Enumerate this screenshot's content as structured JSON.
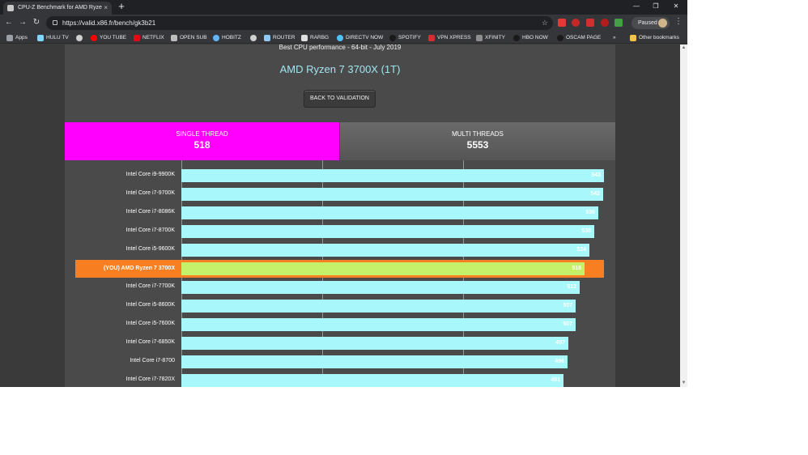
{
  "browser": {
    "tab_title": "CPU-Z Benchmark for AMD Ryze",
    "tab_close": "×",
    "new_tab": "+",
    "url": "https://valid.x86.fr/bench/gk3b21",
    "profile_label": "Paused",
    "window_controls": [
      "—",
      "❐",
      "✕"
    ],
    "bookmarks": [
      {
        "label": "Apps",
        "icon": "apps-grid-icon"
      },
      {
        "label": "HULU TV",
        "icon": "hulu-icon"
      },
      {
        "label": "",
        "icon": "globe-icon"
      },
      {
        "label": "YOU TUBE",
        "icon": "youtube-icon"
      },
      {
        "label": "NETFLIX",
        "icon": "netflix-icon"
      },
      {
        "label": "OPEN SUB",
        "icon": "opensub-icon"
      },
      {
        "label": "HOBITZ",
        "icon": "hobitz-icon"
      },
      {
        "label": "",
        "icon": "globe-icon"
      },
      {
        "label": "ROUTER",
        "icon": "router-icon"
      },
      {
        "label": "RARBG",
        "icon": "rarbg-icon"
      },
      {
        "label": "DIRECTV NOW",
        "icon": "directv-icon"
      },
      {
        "label": "SPOTIFY",
        "icon": "spotify-icon"
      },
      {
        "label": "VPN XPRESS",
        "icon": "vpn-icon"
      },
      {
        "label": "XFINITY",
        "icon": "xfinity-icon"
      },
      {
        "label": "HBO NOW",
        "icon": "hbo-icon"
      },
      {
        "label": "OSCAM PAGE",
        "icon": "oscam-icon"
      }
    ],
    "bookmarks_overflow": "»",
    "other_bookmarks": "Other bookmarks"
  },
  "page": {
    "subtitle": "Best CPU performance - 64-bit - July 2019",
    "cpu_title": "AMD Ryzen 7 3700X (1T)",
    "back_button": "BACK TO VALIDATION",
    "tabs": {
      "single": {
        "label": "SINGLE THREAD",
        "score": "518"
      },
      "multi": {
        "label": "MULTI THREADS",
        "score": "5553"
      }
    }
  },
  "chart_data": {
    "type": "bar",
    "orientation": "horizontal",
    "categories": [
      "Intel Core i9-9900K",
      "Intel Core i7-9700K",
      "Intel Core i7-8086K",
      "Intel Core i7-8700K",
      "Intel Core i5-9600K",
      "(YOU) AMD Ryzen 7 3700X",
      "Intel Core i7-7700K",
      "Intel Core i5-8600K",
      "Intel Core i5-7600K",
      "Intel Core i7-6850K",
      "Intel Core i7-8700",
      "Intel Core i7-7820X"
    ],
    "values": [
      543,
      542,
      536,
      530,
      524,
      518,
      512,
      507,
      507,
      497,
      496,
      491
    ],
    "value_labels": [
      "543",
      "542",
      "536",
      "530",
      "524",
      "518",
      "512",
      "507",
      "507",
      "497",
      "496",
      "491"
    ],
    "highlight_index": 5,
    "xlim": [
      0,
      543
    ],
    "grid": true,
    "bar_color": "#a8f7fb",
    "highlight_bar_color": "#c5f06a",
    "highlight_row_color": "#f77f22"
  },
  "colors": {
    "single_tab": "#ff00ff",
    "title": "#9fe6f0"
  }
}
